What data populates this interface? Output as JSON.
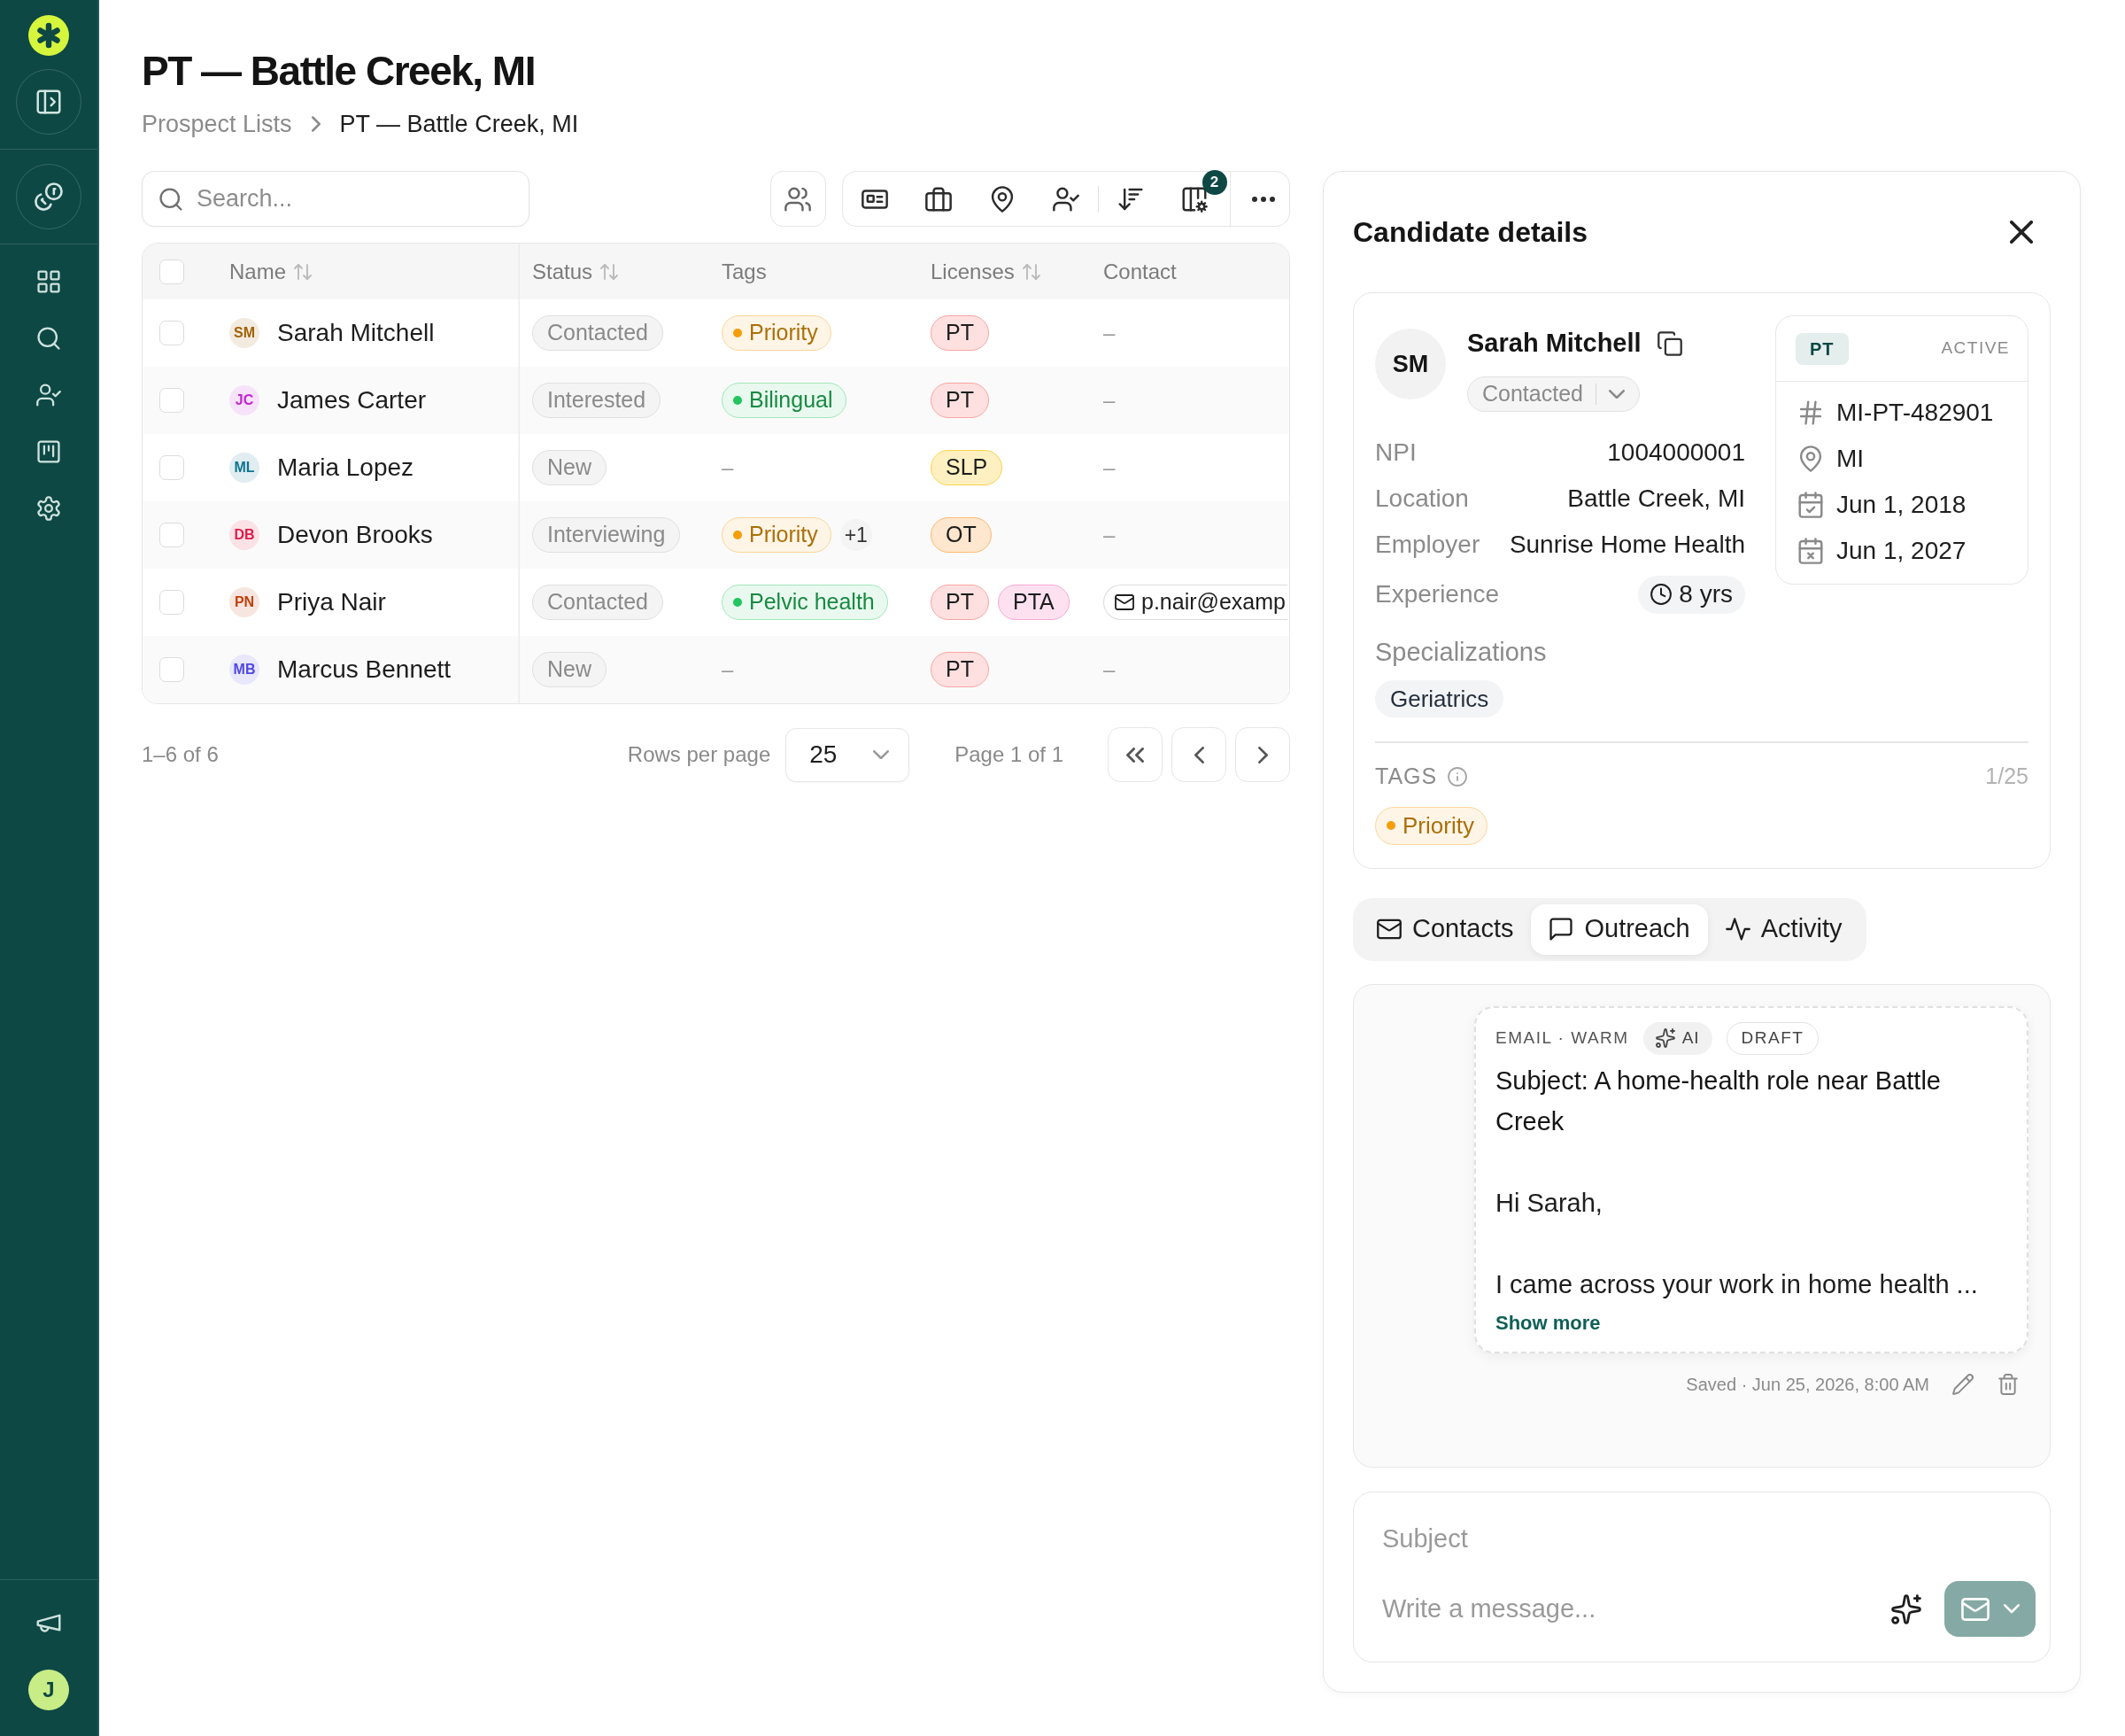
{
  "sidebar": {
    "user_initial": "J"
  },
  "header": {
    "title": "PT — Battle Creek, MI",
    "breadcrumb": [
      {
        "label": "Prospect Lists",
        "current": false
      },
      {
        "label": "PT — Battle Creek, MI",
        "current": true
      }
    ]
  },
  "toolbar": {
    "search": {
      "placeholder": "Search..."
    },
    "columns_badge": "2"
  },
  "table": {
    "all_checked": false,
    "columns": [
      {
        "label": "Name",
        "sortable": true
      },
      {
        "label": "Status",
        "sortable": true
      },
      {
        "label": "Tags",
        "sortable": false
      },
      {
        "label": "Licenses",
        "sortable": true
      },
      {
        "label": "Contact",
        "sortable": false
      }
    ],
    "rows": [
      {
        "checked": false,
        "initials": "SM",
        "color": "#a16207",
        "name": "Sarah Mitchell",
        "status": "Contacted",
        "tags": [
          {
            "label": "Priority",
            "color": "#f59e0b"
          }
        ],
        "licenses": [
          {
            "label": "PT",
            "color": "#fca5a5"
          }
        ],
        "contact": {
          "kind": "none",
          "text": "–"
        }
      },
      {
        "checked": false,
        "initials": "JC",
        "color": "#c026d3",
        "name": "James Carter",
        "status": "Interested",
        "tags": [
          {
            "label": "Bilingual",
            "color": "#22c55e"
          }
        ],
        "licenses": [
          {
            "label": "PT",
            "color": "#fca5a5"
          }
        ],
        "contact": {
          "kind": "none",
          "text": "–"
        }
      },
      {
        "checked": false,
        "initials": "ML",
        "color": "#0e7490",
        "name": "Maria Lopez",
        "status": "New",
        "tags_empty": "–",
        "licenses": [
          {
            "label": "SLP",
            "color": "#fcd34d"
          }
        ],
        "contact": {
          "kind": "none",
          "text": "–"
        }
      },
      {
        "checked": false,
        "initials": "DB",
        "color": "#e11d48",
        "name": "Devon Brooks",
        "status": "Interviewing",
        "tags": [
          {
            "label": "Priority",
            "color": "#f59e0b"
          }
        ],
        "tags_more": "+1",
        "licenses": [
          {
            "label": "OT",
            "color": "#fdba74"
          }
        ],
        "contact": {
          "kind": "none",
          "text": "–"
        }
      },
      {
        "checked": false,
        "initials": "PN",
        "color": "#c2410c",
        "name": "Priya Nair",
        "status": "Contacted",
        "tags": [
          {
            "label": "Pelvic health",
            "color": "#22c55e"
          }
        ],
        "licenses": [
          {
            "label": "PT",
            "color": "#fca5a5"
          },
          {
            "label": "PTA",
            "color": "#f9a8d4"
          }
        ],
        "contact": {
          "kind": "email",
          "text": "p.nair@examp"
        }
      },
      {
        "checked": false,
        "initials": "MB",
        "color": "#4f46e5",
        "name": "Marcus Bennett",
        "status": "New",
        "tags_empty": "–",
        "licenses": [
          {
            "label": "PT",
            "color": "#fca5a5"
          }
        ],
        "contact": {
          "kind": "none",
          "text": "–"
        }
      }
    ]
  },
  "pagination": {
    "summary": "1–6 of 6",
    "rows_per_page_label": "Rows per page",
    "rows_per_page": "25",
    "page_label": "Page 1 of 1"
  },
  "details": {
    "title": "Candidate details",
    "profile": {
      "initials": "SM",
      "name": "Sarah Mitchell",
      "status": "Contacted",
      "fields": [
        {
          "kind": "text",
          "label": "NPI",
          "value": "1004000001"
        },
        {
          "kind": "text",
          "label": "Location",
          "value": "Battle Creek, MI"
        },
        {
          "kind": "text",
          "label": "Employer",
          "value": "Sunrise Home Health"
        },
        {
          "kind": "duration",
          "label": "Experience",
          "value": "8 yrs"
        }
      ],
      "specializations": {
        "label": "Specializations",
        "items": [
          "Geriatrics"
        ]
      },
      "tags": {
        "label": "TAGS",
        "count": "1/25",
        "items": [
          {
            "label": "Priority",
            "color": "#f59e0b"
          }
        ]
      }
    },
    "license": {
      "type": "PT",
      "status": "ACTIVE",
      "rows": [
        {
          "kind": "number",
          "text": "MI-PT-482901"
        },
        {
          "kind": "state",
          "text": "MI"
        },
        {
          "kind": "issued",
          "text": "Jun 1, 2018"
        },
        {
          "kind": "expires",
          "text": "Jun 1, 2027"
        }
      ]
    },
    "tabs": [
      {
        "kind": "contacts",
        "label": "Contacts",
        "selected": false
      },
      {
        "kind": "outreach",
        "label": "Outreach",
        "selected": true
      },
      {
        "kind": "activity",
        "label": "Activity",
        "selected": false
      }
    ],
    "draft": {
      "meta": "EMAIL · WARM",
      "ai_label": "AI",
      "status": "DRAFT",
      "subject": "Subject: A home-health role near Battle Creek",
      "body": "Hi Sarah,\n\nI came across your work in home health ...",
      "show_more": "Show more",
      "saved": "Saved · Jun 25, 2026, 8:00 AM"
    },
    "compose": {
      "subject_placeholder": "Subject",
      "message_placeholder": "Write a message...",
      "send_disabled": true
    }
  }
}
